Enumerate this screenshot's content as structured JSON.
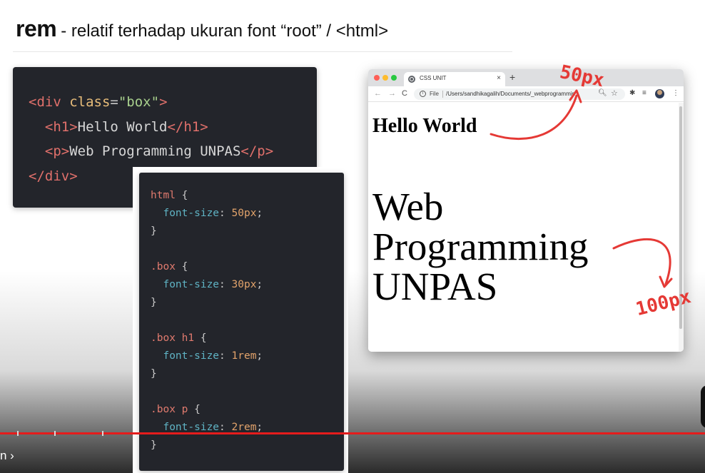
{
  "slide": {
    "title_keyword": "rem",
    "title_rest": "- relatif terhadap ukuran font “root” / <html>"
  },
  "html_code": {
    "lines": [
      [
        {
          "t": "<div ",
          "c": "t-tag"
        },
        {
          "t": "class",
          "c": "t-attr"
        },
        {
          "t": "=",
          "c": "t-punct"
        },
        {
          "t": "\"box\"",
          "c": "t-str"
        },
        {
          "t": ">",
          "c": "t-tag"
        }
      ],
      [
        {
          "t": "  <h1>",
          "c": "t-tag"
        },
        {
          "t": "Hello World",
          "c": "t-txt"
        },
        {
          "t": "</h1>",
          "c": "t-tag"
        }
      ],
      [
        {
          "t": "  <p>",
          "c": "t-tag"
        },
        {
          "t": "Web Programming UNPAS",
          "c": "t-txt"
        },
        {
          "t": "</p>",
          "c": "t-tag"
        }
      ],
      [
        {
          "t": "</div>",
          "c": "t-tag"
        }
      ]
    ]
  },
  "css_code": {
    "lines": [
      [
        {
          "t": "html ",
          "c": "t-sel"
        },
        {
          "t": "{",
          "c": "t-punct"
        }
      ],
      [
        {
          "t": "  font-size",
          "c": "t-prop"
        },
        {
          "t": ": ",
          "c": "t-punct"
        },
        {
          "t": "50px",
          "c": "t-val"
        },
        {
          "t": ";",
          "c": "t-punct"
        }
      ],
      [
        {
          "t": "}",
          "c": "t-punct"
        }
      ],
      [],
      [
        {
          "t": ".box ",
          "c": "t-sel"
        },
        {
          "t": "{",
          "c": "t-punct"
        }
      ],
      [
        {
          "t": "  font-size",
          "c": "t-prop"
        },
        {
          "t": ": ",
          "c": "t-punct"
        },
        {
          "t": "30px",
          "c": "t-val"
        },
        {
          "t": ";",
          "c": "t-punct"
        }
      ],
      [
        {
          "t": "}",
          "c": "t-punct"
        }
      ],
      [],
      [
        {
          "t": ".box h1 ",
          "c": "t-sel"
        },
        {
          "t": "{",
          "c": "t-punct"
        }
      ],
      [
        {
          "t": "  font-size",
          "c": "t-prop"
        },
        {
          "t": ": ",
          "c": "t-punct"
        },
        {
          "t": "1rem",
          "c": "t-val"
        },
        {
          "t": ";",
          "c": "t-punct"
        }
      ],
      [
        {
          "t": "}",
          "c": "t-punct"
        }
      ],
      [],
      [
        {
          "t": ".box p ",
          "c": "t-sel"
        },
        {
          "t": "{",
          "c": "t-punct"
        }
      ],
      [
        {
          "t": "  font-size",
          "c": "t-prop"
        },
        {
          "t": ": ",
          "c": "t-punct"
        },
        {
          "t": "2rem",
          "c": "t-val"
        },
        {
          "t": ";",
          "c": "t-punct"
        }
      ],
      [
        {
          "t": "}",
          "c": "t-punct"
        }
      ]
    ]
  },
  "browser": {
    "tab_title": "CSS UNIT",
    "tab_close": "×",
    "new_tab": "+",
    "back_icon": "←",
    "forward_icon": "→",
    "reload_icon": "C",
    "info_icon": "i",
    "file_label": "File",
    "url": "/Users/sandhikagalih/Documents/_webprogrammin...",
    "zoom_icon": "magnifier-icon",
    "star_icon": "star-icon",
    "puzzle_icon": "puzzle-icon",
    "queue_icon": "reading-list-icon",
    "menu_icon": "⋮",
    "page": {
      "h1": "Hello World",
      "p": "Web Programming UNPAS"
    }
  },
  "annotations": {
    "h1_size": "50px",
    "p_size": "100px",
    "color": "#e53935"
  },
  "player": {
    "chapter_label": "n ›",
    "progress_color": "#e51c1c"
  }
}
